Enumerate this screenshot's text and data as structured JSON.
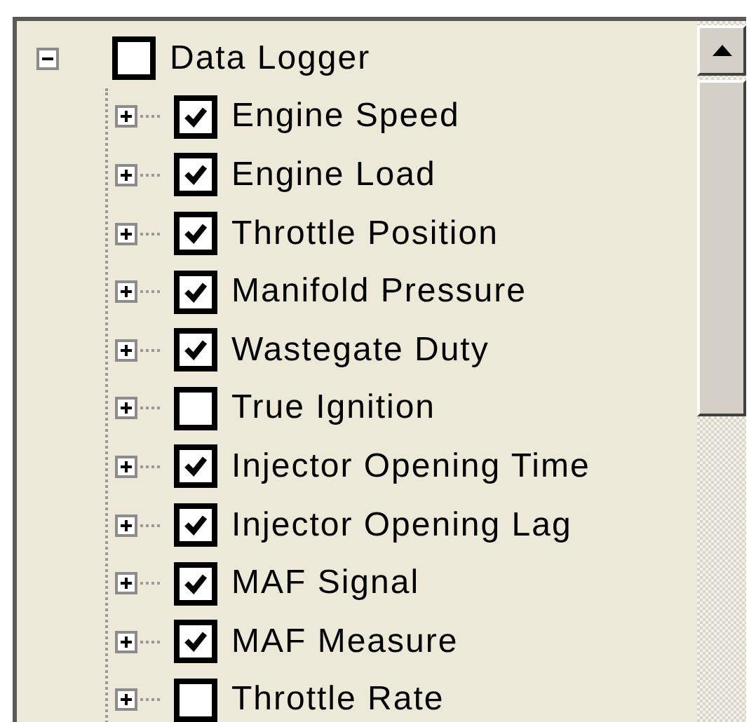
{
  "tree": [
    {
      "label": "Data Logger",
      "checked": false,
      "expanded": true,
      "children": [
        {
          "label": "Engine Speed",
          "checked": true,
          "expanded": false
        },
        {
          "label": "Engine Load",
          "checked": true,
          "expanded": false
        },
        {
          "label": "Throttle Position",
          "checked": true,
          "expanded": false
        },
        {
          "label": "Manifold Pressure",
          "checked": true,
          "expanded": false
        },
        {
          "label": "Wastegate Duty",
          "checked": true,
          "expanded": false
        },
        {
          "label": "True Ignition",
          "checked": false,
          "expanded": false
        },
        {
          "label": "Injector Opening Time",
          "checked": true,
          "expanded": false
        },
        {
          "label": "Injector Opening Lag",
          "checked": true,
          "expanded": false
        },
        {
          "label": "MAF Signal",
          "checked": true,
          "expanded": false
        },
        {
          "label": "MAF Measure",
          "checked": true,
          "expanded": false
        },
        {
          "label": "Throttle Rate",
          "checked": false,
          "expanded": false
        }
      ]
    }
  ]
}
